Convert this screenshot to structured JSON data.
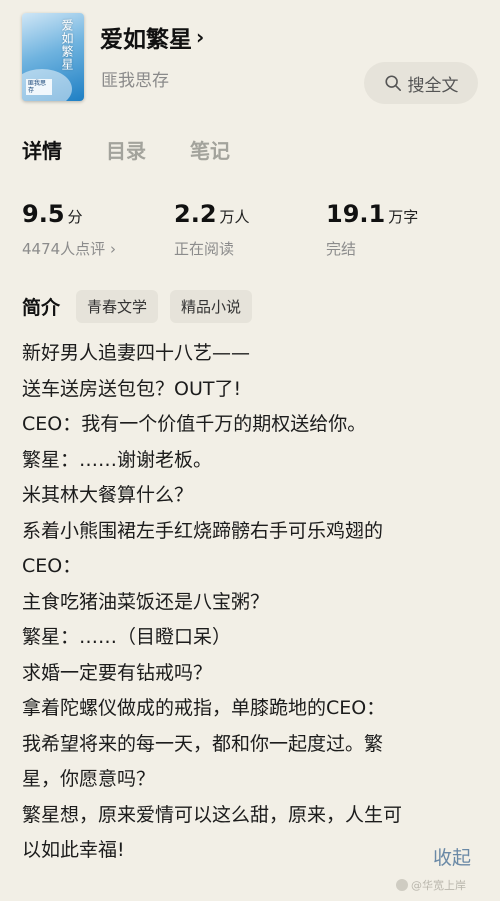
{
  "book": {
    "title": "爱如繁星",
    "author": "匪我思存",
    "cover_title": "爱如繁星",
    "cover_author": "匪我思存"
  },
  "search": {
    "label": "搜全文"
  },
  "tabs": [
    {
      "label": "详情",
      "active": true
    },
    {
      "label": "目录",
      "active": false
    },
    {
      "label": "笔记",
      "active": false
    }
  ],
  "stats": {
    "rating": {
      "value": "9.5",
      "unit": "分",
      "sub": "4474人点评 ›"
    },
    "readers": {
      "value": "2.2",
      "unit": "万人",
      "sub": "正在阅读"
    },
    "words": {
      "value": "19.1",
      "unit": "万字",
      "sub": "完结"
    }
  },
  "intro": {
    "label": "简介",
    "tags": [
      "青春文学",
      "精品小说"
    ],
    "lines": [
      "新好男人追妻四十八艺——",
      "送车送房送包包？OUT了!",
      "CEO：我有一个价值千万的期权送给你。",
      "繁星：……谢谢老板。",
      "米其林大餐算什么？",
      "系着小熊围裙左手红烧蹄髈右手可乐鸡翅的",
      "CEO：",
      "主食吃猪油菜饭还是八宝粥？",
      "繁星：……（目瞪口呆）",
      "求婚一定要有钻戒吗？",
      "拿着陀螺仪做成的戒指，单膝跪地的CEO：",
      "我希望将来的每一天，都和你一起度过。繁",
      "星，你愿意吗？",
      "繁星想，原来爱情可以这么甜，原来，人生可",
      "以如此幸福!"
    ],
    "collapse_label": "收起"
  },
  "watermark": {
    "text": "@华宽上岸"
  },
  "colors": {
    "background": "#f2efe6",
    "link": "#6a89a6",
    "muted": "#8c8c8c"
  }
}
